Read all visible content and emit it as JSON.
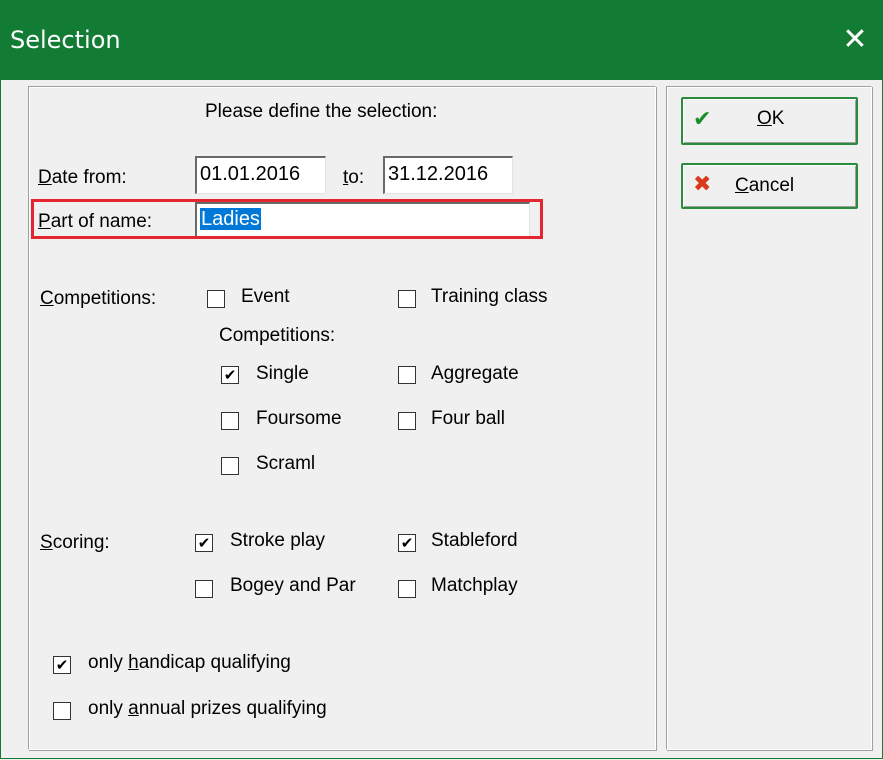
{
  "window": {
    "title": "Selection",
    "close_glyph": "✕"
  },
  "form": {
    "heading": "Please define the selection:",
    "date_from_label": "Date from:",
    "date_from_value": "01.01.2016",
    "to_label": "to:",
    "date_to_value": "31.12.2016",
    "part_of_name_label": "Part of name:",
    "part_of_name_value": "Ladies"
  },
  "competitions": {
    "label": "Competitions:",
    "event": {
      "label": "Event",
      "checked": false
    },
    "training_class": {
      "label": "Training class",
      "checked": false
    },
    "sub_heading": "Competitions:",
    "single": {
      "label": "Single",
      "checked": true
    },
    "aggregate": {
      "label": "Aggregate",
      "checked": false
    },
    "foursome": {
      "label": "Foursome",
      "checked": false
    },
    "four_ball": {
      "label": "Four ball",
      "checked": false
    },
    "scraml": {
      "label": "Scraml",
      "checked": false
    }
  },
  "scoring": {
    "label": "Scoring:",
    "stroke_play": {
      "label": "Stroke play",
      "checked": true
    },
    "stableford": {
      "label": "Stableford",
      "checked": true
    },
    "bogey_par": {
      "label": "Bogey and Par",
      "checked": false
    },
    "matchplay": {
      "label": "Matchplay",
      "checked": false
    }
  },
  "options": {
    "handicap": {
      "label": "only handicap qualifying",
      "checked": true
    },
    "annual": {
      "label": "only annual prizes qualifying",
      "checked": false
    }
  },
  "buttons": {
    "ok_label": "OK",
    "ok_icon": "check-icon",
    "cancel_label": "Cancel",
    "cancel_icon": "cross-icon"
  },
  "colors": {
    "titlebar": "#127c35",
    "highlight_box": "#e3262f",
    "selection": "#0078d7",
    "ok_check": "#1a8f2c",
    "cancel_cross": "#d93a1c"
  }
}
